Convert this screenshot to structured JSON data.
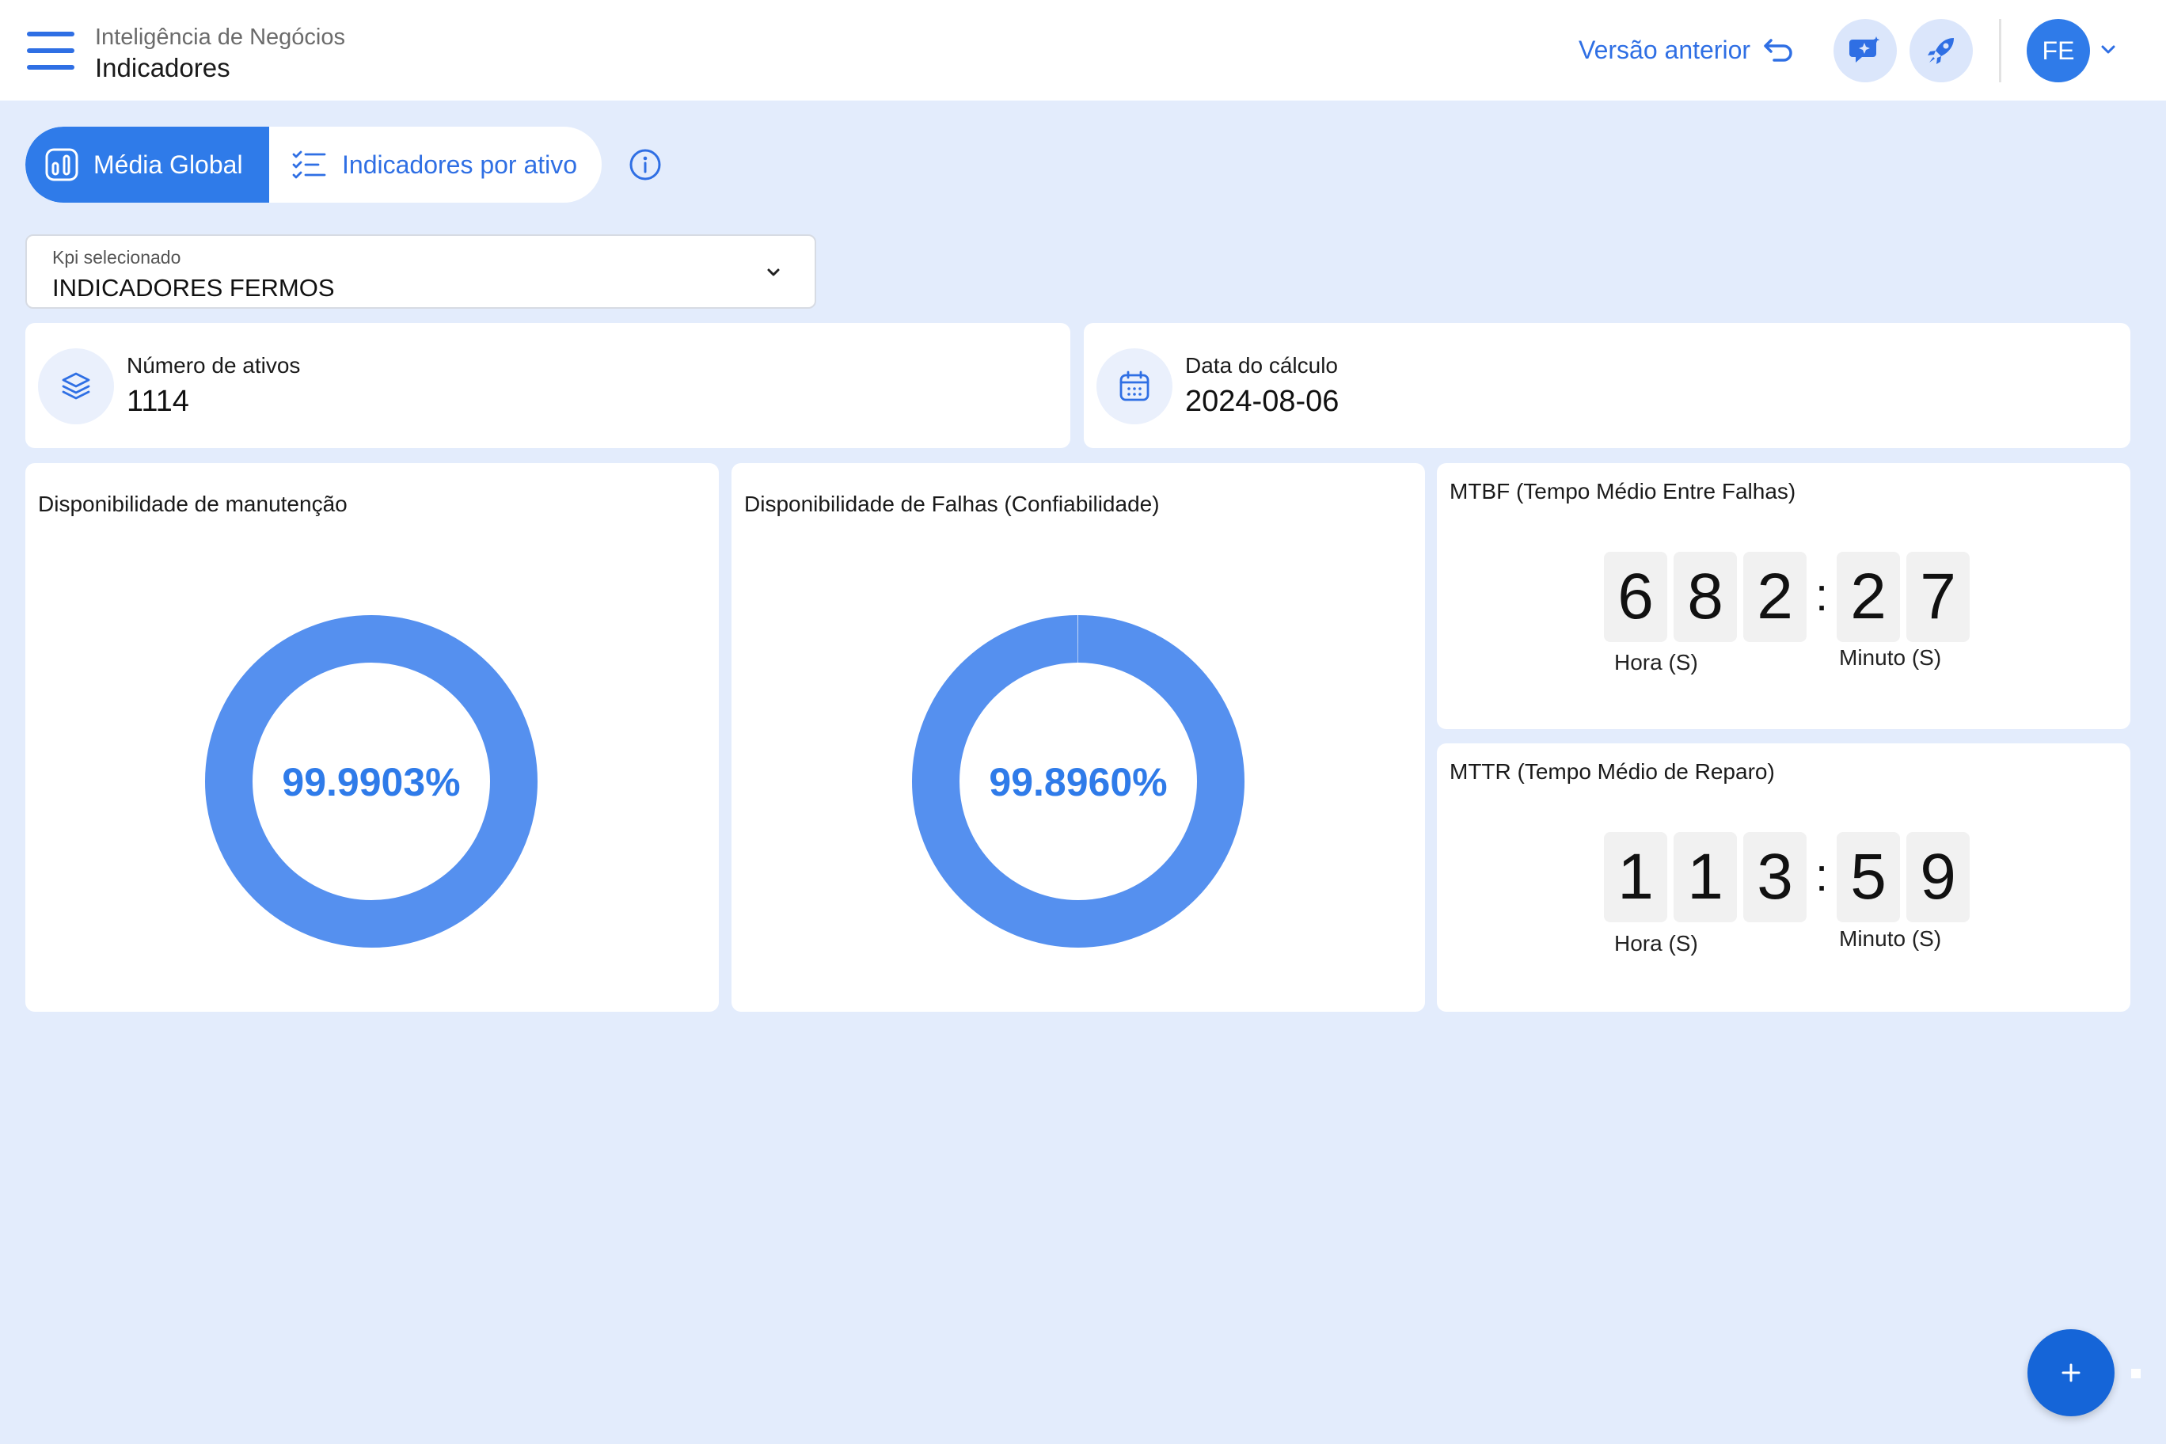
{
  "header": {
    "subtitle": "Inteligência de Negócios",
    "title": "Indicadores",
    "prev_version_label": "Versão anterior",
    "avatar_initials": "FE"
  },
  "tabs": [
    {
      "label": "Média Global",
      "active": true
    },
    {
      "label": "Indicadores por ativo",
      "active": false
    }
  ],
  "kpi_select": {
    "label": "Kpi selecionado",
    "value": "INDICADORES FERMOS"
  },
  "stats": {
    "assets": {
      "label": "Número de ativos",
      "value": "1114"
    },
    "calc_date": {
      "label": "Data do cálculo",
      "value": "2024-08-06"
    }
  },
  "availability_maintenance": {
    "title": "Disponibilidade de manutenção",
    "value_text": "99.9903%",
    "percent": 99.9903
  },
  "availability_failures": {
    "title": "Disponibilidade de Falhas (Confiabilidade)",
    "value_text": "99.8960%",
    "percent": 99.896
  },
  "mtbf": {
    "title": "MTBF (Tempo Médio Entre Falhas)",
    "hour_digits": [
      "6",
      "8",
      "2"
    ],
    "minute_digits": [
      "2",
      "7"
    ],
    "hour_label": "Hora (S)",
    "minute_label": "Minuto (S)"
  },
  "mttr": {
    "title": "MTTR (Tempo Médio de Reparo)",
    "hour_digits": [
      "1",
      "1",
      "3"
    ],
    "minute_digits": [
      "5",
      "9"
    ],
    "hour_label": "Hora (S)",
    "minute_label": "Minuto (S)"
  },
  "colors": {
    "accent": "#2f7be9",
    "donut_ring": "#5590ef",
    "background": "#e3ecfc"
  }
}
